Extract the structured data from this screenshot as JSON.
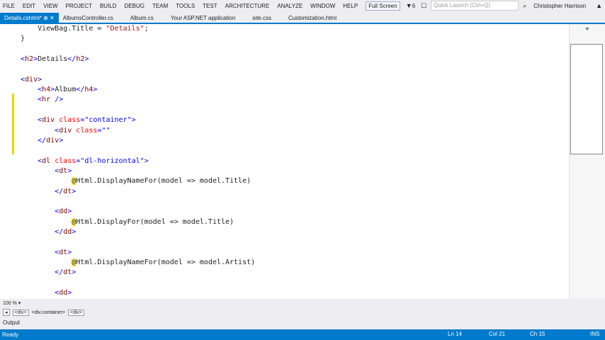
{
  "menu": [
    "FILE",
    "EDIT",
    "VIEW",
    "PROJECT",
    "BUILD",
    "DEBUG",
    "TEAM",
    "TOOLS",
    "TEST",
    "ARCHITECTURE",
    "ANALYZE",
    "WINDOW",
    "HELP"
  ],
  "fullscreen": "Full Screen",
  "notifications": "6",
  "quick_launch_placeholder": "Quick Launch (Ctrl+Q)",
  "user": "Christopher Harrison",
  "tabs": [
    "Details.cshtml*",
    "AlbumsController.cs",
    "Album.cs",
    "Your ASP.NET application",
    "site.css",
    "Customization.html"
  ],
  "code": [
    [
      [
        "pl",
        "    ViewBag.Title = "
      ],
      [
        "str",
        "\"Details\""
      ],
      [
        "pl",
        ";"
      ]
    ],
    [
      [
        "pl",
        "}"
      ]
    ],
    [],
    [
      [
        "br",
        "<"
      ],
      [
        "tag",
        "h2"
      ],
      [
        "br",
        ">"
      ],
      [
        "pl",
        "Details"
      ],
      [
        "br",
        "</"
      ],
      [
        "tag",
        "h2"
      ],
      [
        "br",
        ">"
      ]
    ],
    [],
    [
      [
        "br",
        "<"
      ],
      [
        "tag",
        "div"
      ],
      [
        "br",
        ">"
      ]
    ],
    [
      [
        "pl",
        "    "
      ],
      [
        "br",
        "<"
      ],
      [
        "tag",
        "h4"
      ],
      [
        "br",
        ">"
      ],
      [
        "pl",
        "Album"
      ],
      [
        "br",
        "</"
      ],
      [
        "tag",
        "h4"
      ],
      [
        "br",
        ">"
      ]
    ],
    [
      [
        "pl",
        "    "
      ],
      [
        "br",
        "<"
      ],
      [
        "tag",
        "hr"
      ],
      [
        "pl",
        " "
      ],
      [
        "br",
        "/>"
      ]
    ],
    [],
    [
      [
        "pl",
        "    "
      ],
      [
        "br",
        "<"
      ],
      [
        "tag",
        "div"
      ],
      [
        "pl",
        " "
      ],
      [
        "attr",
        "class"
      ],
      [
        "br",
        "="
      ],
      [
        "val",
        "\"container\""
      ],
      [
        "br",
        ">"
      ]
    ],
    [
      [
        "pl",
        "        "
      ],
      [
        "br",
        "<"
      ],
      [
        "tag",
        "div"
      ],
      [
        "pl",
        " "
      ],
      [
        "attr",
        "class"
      ],
      [
        "br",
        "="
      ],
      [
        "val",
        "\"\""
      ]
    ],
    [
      [
        "pl",
        "    "
      ],
      [
        "br",
        "</"
      ],
      [
        "tag",
        "div"
      ],
      [
        "br",
        ">"
      ]
    ],
    [],
    [
      [
        "pl",
        "    "
      ],
      [
        "br",
        "<"
      ],
      [
        "tag",
        "dl"
      ],
      [
        "pl",
        " "
      ],
      [
        "attr",
        "class"
      ],
      [
        "br",
        "="
      ],
      [
        "val",
        "\"dl-horizontal\""
      ],
      [
        "br",
        ">"
      ]
    ],
    [
      [
        "pl",
        "        "
      ],
      [
        "br",
        "<"
      ],
      [
        "tag",
        "dt"
      ],
      [
        "br",
        ">"
      ]
    ],
    [
      [
        "pl",
        "            "
      ],
      [
        "at",
        "@"
      ],
      [
        "pl",
        "Html.DisplayNameFor(model => model.Title)"
      ]
    ],
    [
      [
        "pl",
        "        "
      ],
      [
        "br",
        "</"
      ],
      [
        "tag",
        "dt"
      ],
      [
        "br",
        ">"
      ]
    ],
    [],
    [
      [
        "pl",
        "        "
      ],
      [
        "br",
        "<"
      ],
      [
        "tag",
        "dd"
      ],
      [
        "br",
        ">"
      ]
    ],
    [
      [
        "pl",
        "            "
      ],
      [
        "at",
        "@"
      ],
      [
        "pl",
        "Html.DisplayFor(model => model.Title)"
      ]
    ],
    [
      [
        "pl",
        "        "
      ],
      [
        "br",
        "</"
      ],
      [
        "tag",
        "dd"
      ],
      [
        "br",
        ">"
      ]
    ],
    [],
    [
      [
        "pl",
        "        "
      ],
      [
        "br",
        "<"
      ],
      [
        "tag",
        "dt"
      ],
      [
        "br",
        ">"
      ]
    ],
    [
      [
        "pl",
        "            "
      ],
      [
        "at",
        "@"
      ],
      [
        "pl",
        "Html.DisplayNameFor(model => model.Artist)"
      ]
    ],
    [
      [
        "pl",
        "        "
      ],
      [
        "br",
        "</"
      ],
      [
        "tag",
        "dt"
      ],
      [
        "br",
        ">"
      ]
    ],
    [],
    [
      [
        "pl",
        "        "
      ],
      [
        "br",
        "<"
      ],
      [
        "tag",
        "dd"
      ],
      [
        "br",
        ">"
      ]
    ]
  ],
  "zoom": "100 %",
  "breadcrumbs": [
    "<div>",
    "<div.container>",
    "<div>"
  ],
  "output_label": "Output",
  "status": {
    "state": "Ready",
    "ln": "Ln 14",
    "col": "Col 21",
    "ch": "Ch 15",
    "mode": "INS"
  }
}
